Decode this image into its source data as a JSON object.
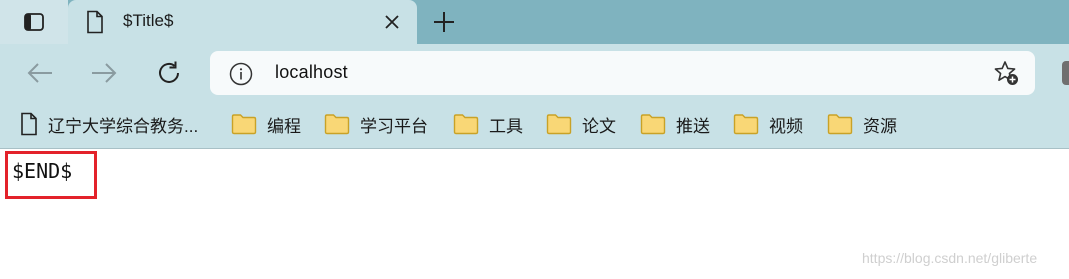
{
  "tab": {
    "title": "$Title$"
  },
  "address_bar": {
    "url": "localhost"
  },
  "bookmarks": [
    {
      "label": "辽宁大学综合教务...",
      "icon": "page-icon"
    },
    {
      "label": "编程",
      "icon": "folder-icon"
    },
    {
      "label": "学习平台",
      "icon": "folder-icon"
    },
    {
      "label": "工具",
      "icon": "folder-icon"
    },
    {
      "label": "论文",
      "icon": "folder-icon"
    },
    {
      "label": "推送",
      "icon": "folder-icon"
    },
    {
      "label": "视频",
      "icon": "folder-icon"
    },
    {
      "label": "资源",
      "icon": "folder-icon"
    }
  ],
  "page": {
    "body_text": "$END$"
  },
  "watermark": "https://blog.csdn.net/gliberte",
  "colors": {
    "tab_strip": "#7fb3bf",
    "toolbar": "#c8e1e6",
    "highlight_border": "#e3222a",
    "folder_fill": "#f9d776",
    "folder_stroke": "#c9a227"
  }
}
